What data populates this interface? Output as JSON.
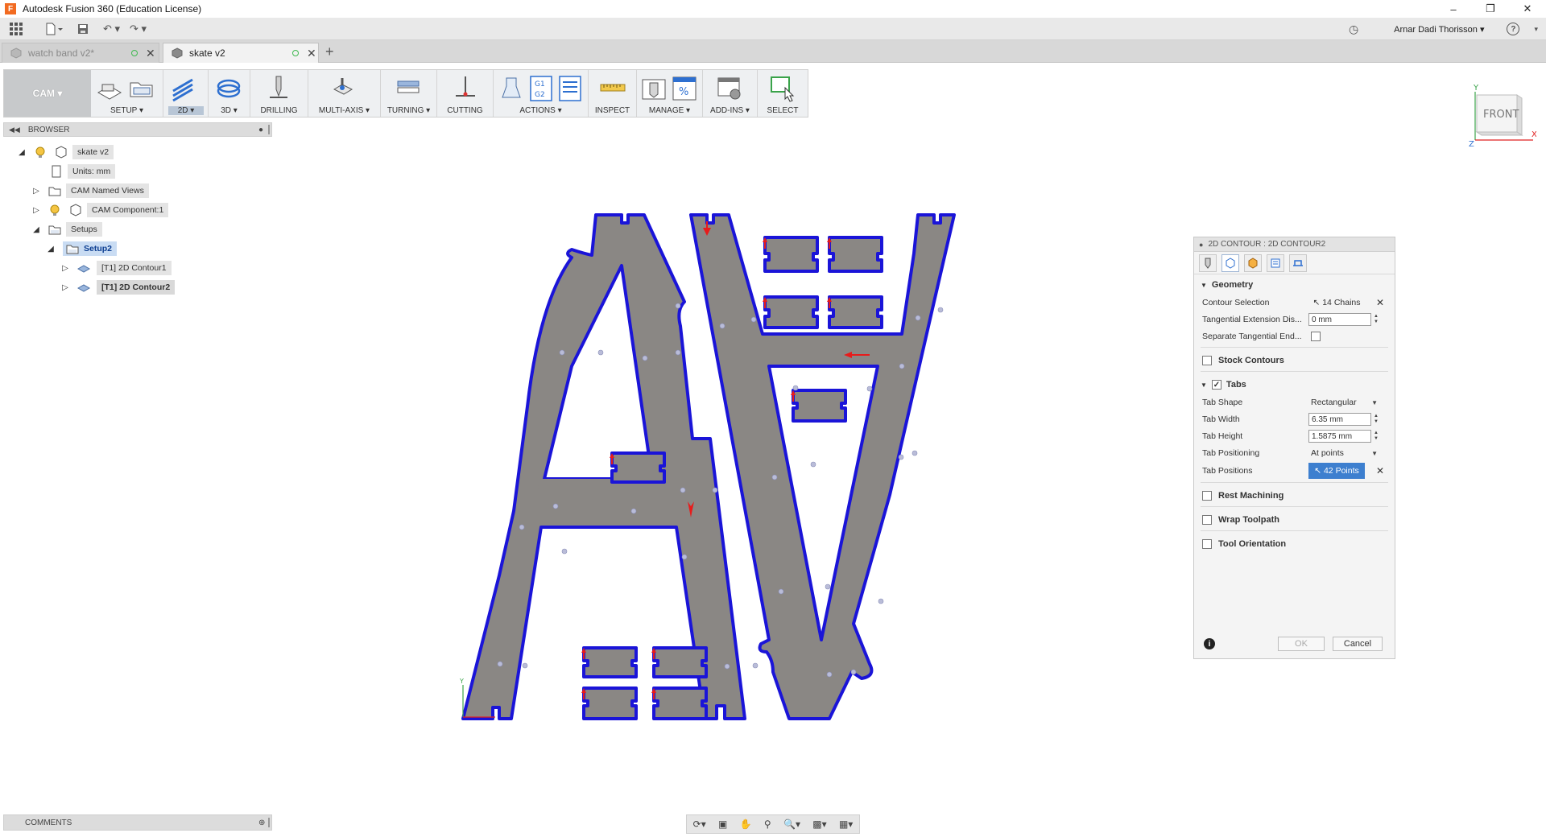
{
  "window": {
    "title": "Autodesk Fusion 360 (Education License)",
    "app_icon_letter": "F"
  },
  "quickbar": {
    "user": "Arnar Dadi Thorisson",
    "help": "?"
  },
  "tabs": [
    {
      "label": "watch band v2*",
      "active": false
    },
    {
      "label": "skate v2",
      "active": true
    }
  ],
  "toolbar": {
    "workspace": "CAM ▾",
    "groups": [
      {
        "label": "SETUP ▾"
      },
      {
        "label": "2D ▾",
        "selected": true
      },
      {
        "label": "3D ▾"
      },
      {
        "label": "DRILLING"
      },
      {
        "label": "MULTI-AXIS ▾"
      },
      {
        "label": "TURNING ▾"
      },
      {
        "label": "CUTTING"
      },
      {
        "label": "ACTIONS ▾"
      },
      {
        "label": "INSPECT"
      },
      {
        "label": "MANAGE ▾"
      },
      {
        "label": "ADD-INS ▾"
      },
      {
        "label": "SELECT"
      }
    ]
  },
  "browser": {
    "title": "BROWSER",
    "nodes": [
      {
        "label": "skate v2"
      },
      {
        "label": "Units: mm"
      },
      {
        "label": "CAM Named Views"
      },
      {
        "label": "CAM Component:1"
      },
      {
        "label": "Setups"
      },
      {
        "label": "Setup2"
      },
      {
        "label": "[T1] 2D Contour1"
      },
      {
        "label": "[T1] 2D Contour2"
      }
    ]
  },
  "viewcube": {
    "face": "FRONT",
    "axis_y": "Y",
    "axis_x": "X",
    "axis_z": "Z"
  },
  "dialog": {
    "title": "2D CONTOUR : 2D CONTOUR2",
    "sections": {
      "geometry": "Geometry",
      "stock_contours": "Stock Contours",
      "tabs": "Tabs",
      "rest_machining": "Rest Machining",
      "wrap_toolpath": "Wrap Toolpath",
      "tool_orientation": "Tool Orientation"
    },
    "fields": {
      "contour_selection_label": "Contour Selection",
      "contour_selection_value": "14 Chains",
      "tangential_ext_label": "Tangential Extension Dis...",
      "tangential_ext_value": "0 mm",
      "separate_tangential_label": "Separate Tangential End...",
      "tab_shape_label": "Tab Shape",
      "tab_shape_value": "Rectangular",
      "tab_width_label": "Tab Width",
      "tab_width_value": "6.35 mm",
      "tab_height_label": "Tab Height",
      "tab_height_value": "1.5875 mm",
      "tab_positioning_label": "Tab Positioning",
      "tab_positioning_value": "At points",
      "tab_positions_label": "Tab Positions",
      "tab_positions_value": "42 Points"
    },
    "ok": "OK",
    "cancel": "Cancel"
  },
  "comments": {
    "title": "COMMENTS"
  },
  "colors": {
    "part_fill": "#8a8784",
    "toolpath": "#1a14d8",
    "tab_marker": "#e81b1b",
    "selection_blue": "#3d7fcf"
  }
}
